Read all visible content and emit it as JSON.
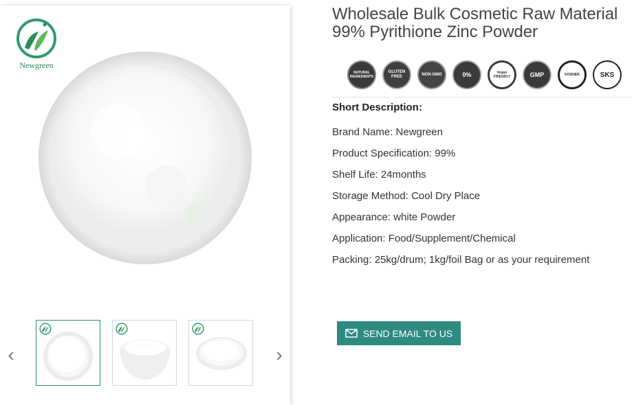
{
  "product": {
    "title": "Wholesale Bulk Cosmetic Raw Material 99% Pyrithione Zinc Powder"
  },
  "brand_logo": {
    "text": "Newgreen",
    "icon": "newgreen-leaf-logo"
  },
  "certifications": [
    {
      "name": "natural-ingredients-badge",
      "text": "NATURAL INGREDIENTS",
      "color": "#3a3a3a"
    },
    {
      "name": "gluten-free-badge",
      "text": "GLUTEN FREE",
      "color": "#3a3a3a"
    },
    {
      "name": "non-gmo-badge",
      "text": "NON GMO",
      "color": "#3a3a3a"
    },
    {
      "name": "no-preservatives-badge",
      "text": "0%",
      "color": "#3a3a3a"
    },
    {
      "name": "vegan-friendly-badge",
      "text": "Vegan FRIENDLY",
      "color": "#3a3a3a"
    },
    {
      "name": "gmp-certified-badge",
      "text": "GMP",
      "color": "#3a3a3a"
    },
    {
      "name": "kosher-badge",
      "text": "KOSHER",
      "color": "#3a3a3a"
    },
    {
      "name": "sks-kosher-badge",
      "text": "SKS",
      "color": "#3a3a3a"
    }
  ],
  "short_description": {
    "heading": "Short Description:",
    "lines": [
      "Brand Name: Newgreen",
      "Product Specification: 99%",
      "Shelf Life: 24months",
      "Storage Method: Cool Dry Place",
      "Appearance: white Powder",
      "Application: Food/Supplement/Chemical",
      "Packing: 25kg/drum; 1kg/foil Bag or as your requirement"
    ]
  },
  "gallery": {
    "prev_icon": "chevron-left-icon",
    "next_icon": "chevron-right-icon",
    "thumbnails": [
      "thumbnail-1",
      "thumbnail-2",
      "thumbnail-3"
    ]
  },
  "actions": {
    "send_email_label": "SEND EMAIL TO US"
  },
  "colors": {
    "accent": "#2e8b80",
    "logo_green": "#2f7d55"
  }
}
